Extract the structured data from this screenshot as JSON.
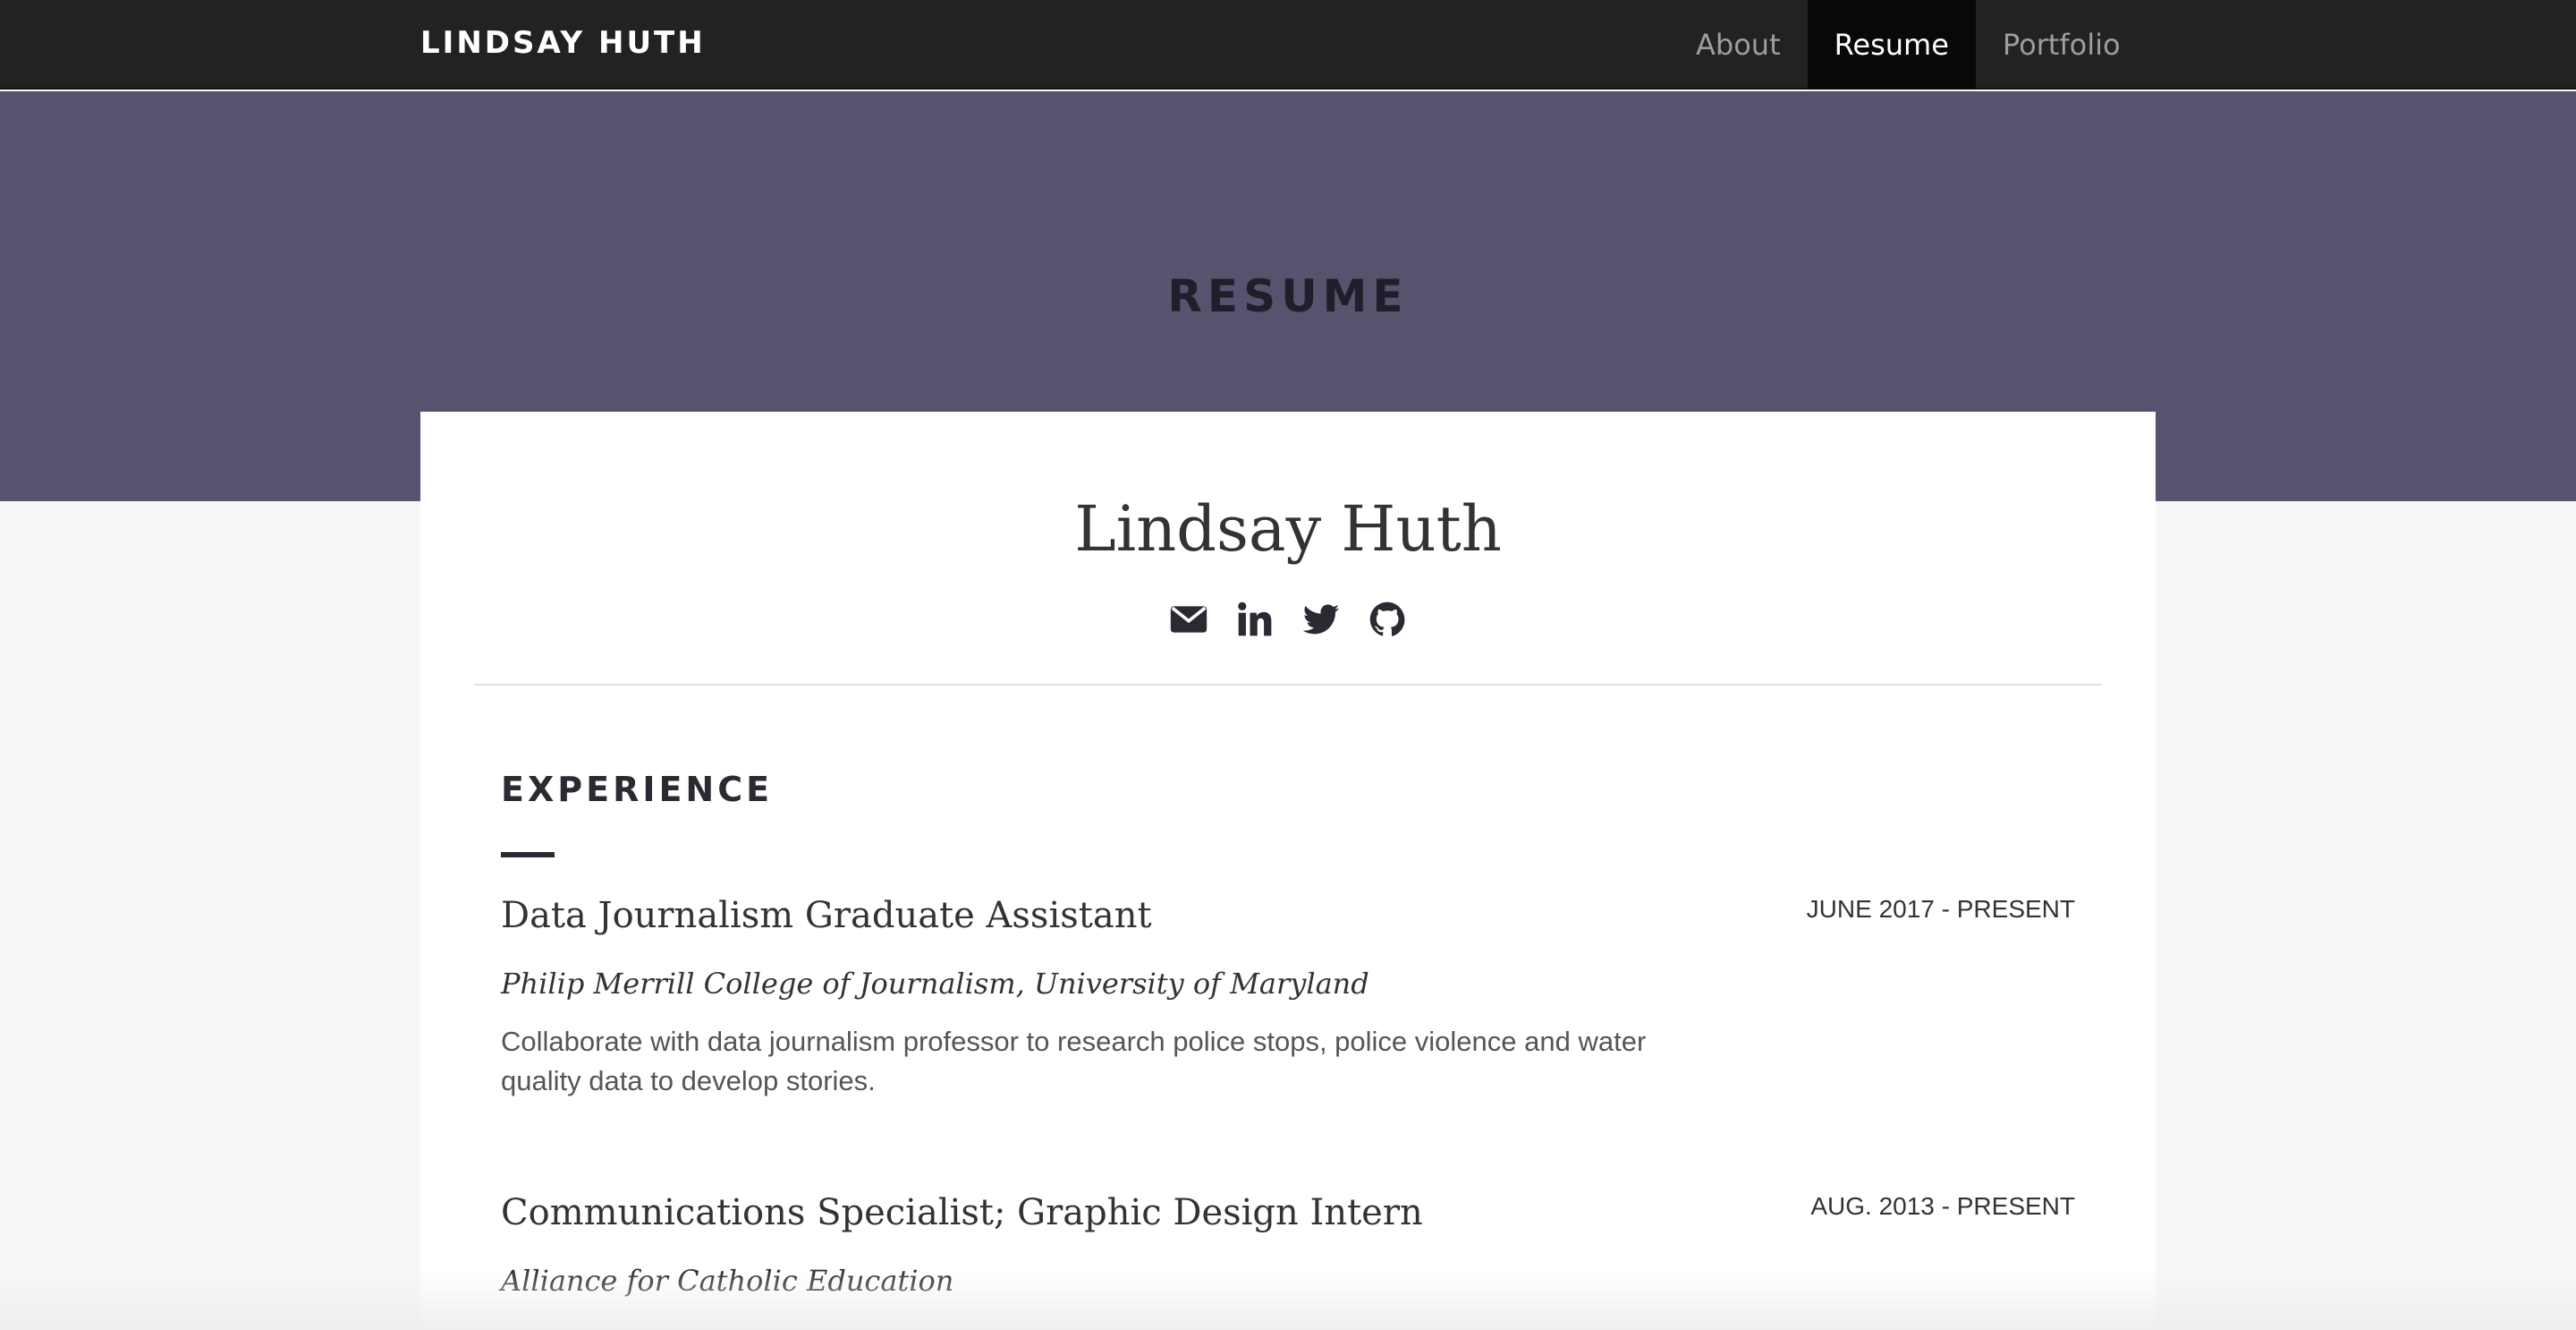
{
  "navbar": {
    "brand": "LINDSAY HUTH",
    "links": [
      {
        "label": "About",
        "active": false
      },
      {
        "label": "Resume",
        "active": true
      },
      {
        "label": "Portfolio",
        "active": false
      }
    ]
  },
  "hero": {
    "title": "RESUME",
    "background_color": "#55536e"
  },
  "profile": {
    "name": "Lindsay Huth",
    "social_icons": [
      "envelope-icon",
      "linkedin-icon",
      "twitter-icon",
      "github-icon"
    ]
  },
  "experience": {
    "heading": "EXPERIENCE",
    "jobs": [
      {
        "title": "Data Journalism Graduate Assistant",
        "date": "JUNE 2017 - PRESENT",
        "org": "Philip Merrill College of Journalism, University of Maryland",
        "description": "Collaborate with data journalism professor to research police stops, police violence and water quality data to develop stories."
      },
      {
        "title": "Communications Specialist; Graphic Design Intern",
        "date": "AUG. 2013 - PRESENT",
        "org": "Alliance for Catholic Education",
        "description": ""
      }
    ]
  }
}
